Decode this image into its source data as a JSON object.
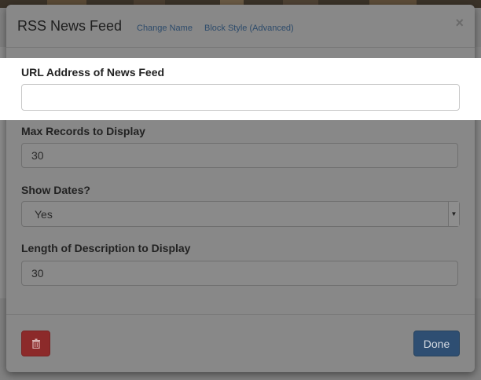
{
  "modal": {
    "title": "RSS News Feed",
    "header_links": {
      "change_name": "Change Name",
      "block_style": "Block Style (Advanced)"
    },
    "close_label": "×"
  },
  "fields": {
    "url": {
      "label": "URL Address of News Feed",
      "value": "",
      "placeholder": ""
    },
    "max_records": {
      "label": "Max Records to Display",
      "value": "30"
    },
    "show_dates": {
      "label": "Show Dates?",
      "selected": "Yes"
    },
    "description_length": {
      "label": "Length of Description to Display",
      "value": "30"
    }
  },
  "footer": {
    "done_label": "Done"
  },
  "icons": {
    "delete": "trash-icon",
    "close": "close-icon",
    "select": "chevron-down-icon"
  },
  "colors": {
    "done": "#2e4e72",
    "delete": "#8c2a2a",
    "link": "#2d4b6b"
  }
}
